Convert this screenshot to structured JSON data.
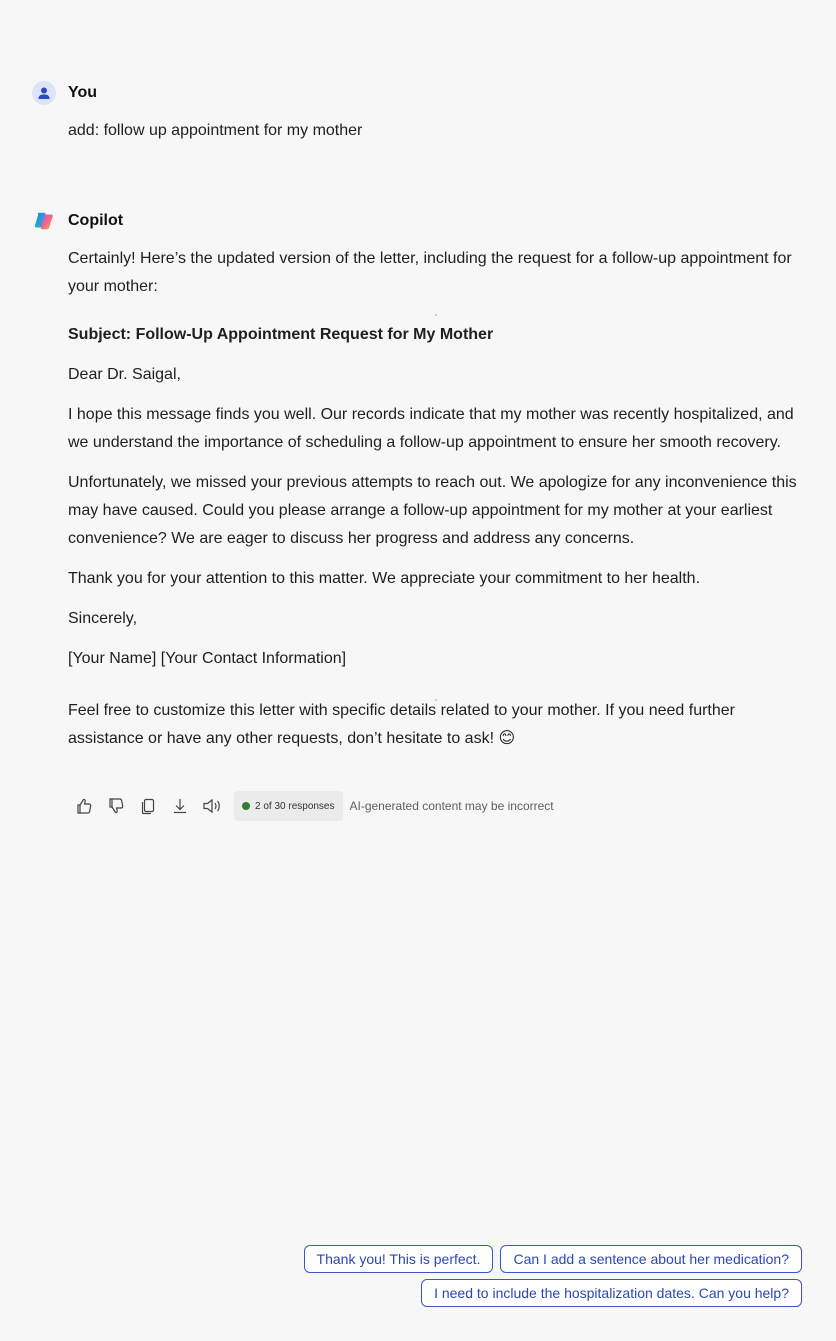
{
  "user_message": {
    "sender": "You",
    "text": "add: follow up appointment for my mother"
  },
  "copilot_message": {
    "sender": "Copilot",
    "intro": "Certainly! Here’s the updated version of the letter, including the request for a follow-up appointment for your mother:",
    "subject": "Subject: Follow-Up Appointment Request for My Mother",
    "greeting": "Dear Dr. Saigal,",
    "paragraph1": "I hope this message finds you well. Our records indicate that my mother was recently hospitalized, and we understand the importance of scheduling a follow-up appointment to ensure her smooth recovery.",
    "paragraph2": "Unfortunately, we missed your previous attempts to reach out. We apologize for any inconvenience this may have caused. Could you please arrange a follow-up appointment for my mother at your earliest convenience? We are eager to discuss her progress and address any concerns.",
    "paragraph3": "Thank you for your attention to this matter. We appreciate your commitment to her health.",
    "closing": "Sincerely,",
    "signature": "[Your Name] [Your Contact Information]",
    "outro": "Feel free to customize this letter with specific details related to your mother. If you need further assistance or have any other requests, don’t hesitate to ask! 😊"
  },
  "actions": {
    "icons": [
      "thumbs-up-icon",
      "thumbs-down-icon",
      "copy-icon",
      "download-icon",
      "read-aloud-icon"
    ],
    "responses_badge": "2 of 30 responses",
    "disclaimer": "AI-generated content may be incorrect"
  },
  "suggestions": [
    "Thank you! This is perfect.",
    "Can I add a sentence about her medication?",
    "I need to include the hospitalization dates. Can you help?"
  ],
  "colors": {
    "background": "#f7f7f7",
    "suggestion_accent": "#2b47b5",
    "status_dot": "#2e7d32"
  }
}
